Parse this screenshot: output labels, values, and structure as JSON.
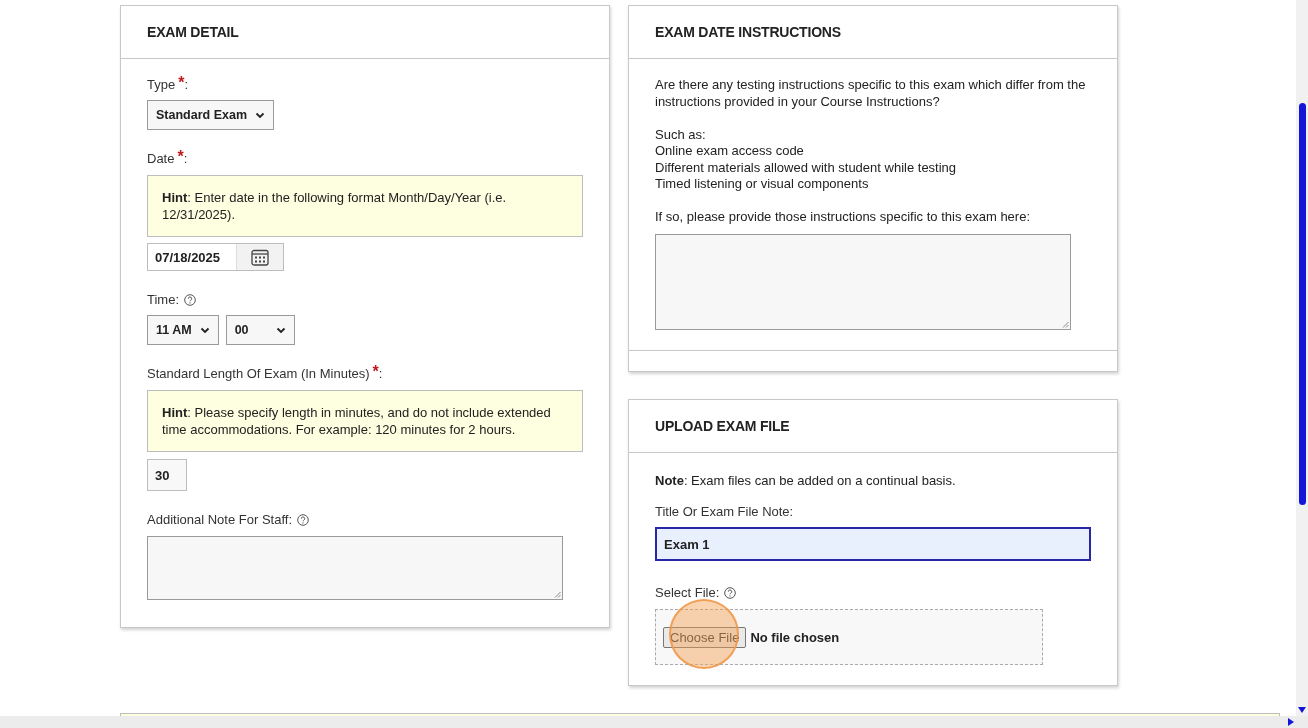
{
  "exam_detail": {
    "title": "EXAM DETAIL",
    "fields": [
      {
        "kind": "select",
        "label": "Type",
        "required_mark": "*",
        "label_end": ":",
        "value": "Standard Exam"
      },
      {
        "kind": "date",
        "label": "Date",
        "required_mark": "*",
        "label_end": ":",
        "hint": "**Hint**: Enter date in the following format Month/Day/Year (i.e. 12/31/2025).",
        "value": "07/18/2025"
      },
      {
        "kind": "time",
        "label": "Time:",
        "help": true,
        "hour": "11 AM",
        "minute": "00"
      },
      {
        "kind": "number",
        "label": "Standard Length Of Exam (In Minutes)",
        "required_mark": "*",
        "label_end": ":",
        "hint": "**Hint**: Please specify length in minutes, and do not include extended time accommodations. For example: 120 minutes for 2 hours.",
        "value": "30"
      },
      {
        "kind": "textarea",
        "label": "Additional Note For Staff:",
        "help": true
      }
    ]
  },
  "exam_date_instructions": {
    "title": "EXAM DATE INSTRUCTIONS",
    "paragraphs": [
      [
        "Are there any testing instructions specific to this exam which differ from the instructions provided in your Course Instructions?"
      ],
      [
        "Such as:",
        "Online exam access code",
        "Different materials allowed with student while testing",
        "Timed listening or visual components"
      ],
      [
        "If so, please provide those instructions specific to this exam here:"
      ]
    ]
  },
  "upload_exam_file": {
    "title": "UPLOAD EXAM FILE",
    "note": "**Note**: Exam files can be added on a continual basis.",
    "title_field": {
      "label": "Title Or Exam File Note:",
      "value": "Exam 1",
      "focused": true
    },
    "file_field": {
      "label": "Select File:",
      "help": true,
      "button": "Choose File",
      "status": "No file chosen"
    }
  }
}
